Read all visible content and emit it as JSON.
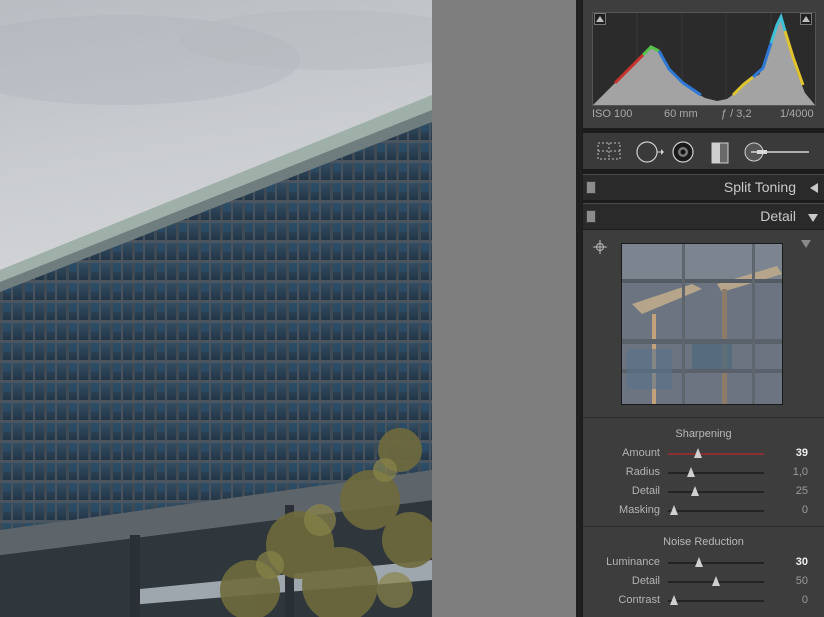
{
  "histogram": {
    "iso": "ISO 100",
    "focal_length": "60 mm",
    "aperture": "ƒ / 3,2",
    "shutter": "1/4000"
  },
  "panels": {
    "split_toning": {
      "title": "Split Toning",
      "collapsed": true
    },
    "detail": {
      "title": "Detail",
      "collapsed": false
    }
  },
  "sharpening": {
    "title": "Sharpening",
    "sliders": [
      {
        "label": "Amount",
        "value": "39",
        "fraction": 0.31,
        "active": true,
        "fill_color": "#8a2f2f"
      },
      {
        "label": "Radius",
        "value": "1,0",
        "fraction": 0.24,
        "active": false,
        "fill_color": ""
      },
      {
        "label": "Detail",
        "value": "25",
        "fraction": 0.28,
        "active": false,
        "fill_color": ""
      },
      {
        "label": "Masking",
        "value": "0",
        "fraction": 0.06,
        "active": false,
        "fill_color": ""
      }
    ]
  },
  "noise_reduction": {
    "title": "Noise Reduction",
    "sliders": [
      {
        "label": "Luminance",
        "value": "30",
        "fraction": 0.32,
        "active": true,
        "fill_color": ""
      },
      {
        "label": "Detail",
        "value": "50",
        "fraction": 0.5,
        "active": false,
        "fill_color": ""
      },
      {
        "label": "Contrast",
        "value": "0",
        "fraction": 0.06,
        "active": false,
        "fill_color": ""
      }
    ]
  },
  "icons": {
    "shadow_clip": "triangle-up-icon",
    "highlight_clip": "triangle-up-icon",
    "crop": "crop-overlay-icon",
    "spot_removal": "spot-removal-icon",
    "red_eye": "red-eye-icon",
    "graduated_filter": "graduated-filter-icon",
    "adjustment_brush": "adjustment-brush-icon",
    "target": "target-crosshair-icon"
  }
}
